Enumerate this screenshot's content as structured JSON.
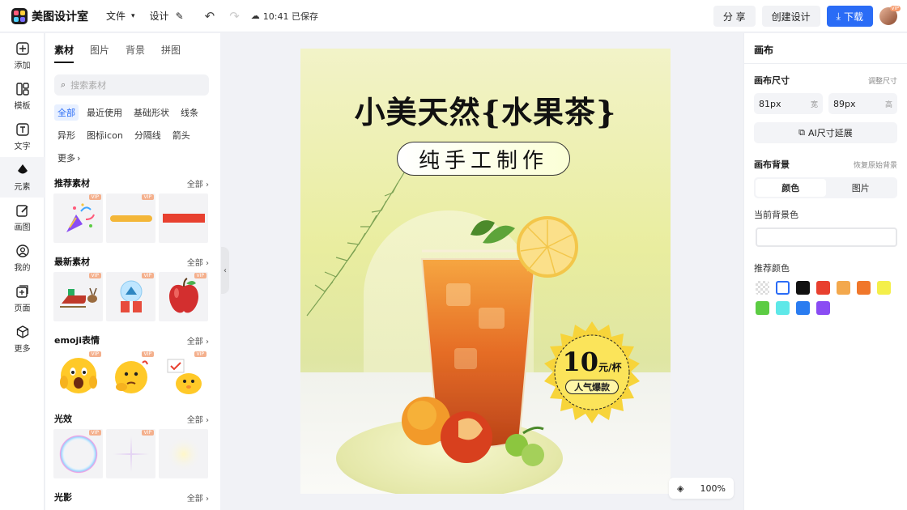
{
  "topbar": {
    "app_name": "美图设计室",
    "menu_file": "文件",
    "menu_design": "设计",
    "save_status": "10:41 已保存",
    "share_label": "分 享",
    "create_label": "创建设计",
    "download_label": "下载",
    "avatar_badge": "VIP"
  },
  "rail": {
    "items": [
      {
        "label": "添加",
        "icon": "plus-square-icon"
      },
      {
        "label": "模板",
        "icon": "template-icon"
      },
      {
        "label": "文字",
        "icon": "text-icon"
      },
      {
        "label": "元素",
        "icon": "shapes-icon"
      },
      {
        "label": "画图",
        "icon": "pen-icon"
      },
      {
        "label": "我的",
        "icon": "user-icon"
      },
      {
        "label": "页面",
        "icon": "add-page-icon"
      },
      {
        "label": "更多",
        "icon": "cube-icon"
      }
    ],
    "active_index": 3
  },
  "panel": {
    "tabs": [
      "素材",
      "图片",
      "背景",
      "拼图"
    ],
    "search_placeholder": "搜索素材",
    "chips": [
      "全部",
      "最近使用",
      "基础形状",
      "线条",
      "异形",
      "图标icon",
      "分隔线",
      "箭头",
      "更多"
    ],
    "sections": [
      {
        "title": "推荐素材",
        "more": "全部"
      },
      {
        "title": "最新素材",
        "more": "全部"
      },
      {
        "title": "emoji表情",
        "more": "全部"
      },
      {
        "title": "光效",
        "more": "全部"
      },
      {
        "title": "光影",
        "more": "全部"
      }
    ],
    "vip_label": "VIP"
  },
  "poster": {
    "title": "小美天然{水果茶}",
    "subtitle": "纯手工制作",
    "price": "10",
    "price_unit": "元/杯",
    "tag": "人气爆款"
  },
  "zoom": {
    "level": "100%"
  },
  "right": {
    "header": "画布",
    "size_label": "画布尺寸",
    "size_action": "调整尺寸",
    "width_value": "81px",
    "width_unit": "宽",
    "height_value": "89px",
    "height_unit": "高",
    "ai_expand": "AI尺寸延展",
    "bg_label": "画布背景",
    "bg_reset": "恢复原始背景",
    "seg_color": "颜色",
    "seg_image": "图片",
    "current_bg": "当前背景色",
    "recommend": "推荐颜色",
    "colors": [
      "transparent",
      "#ffffff",
      "#111111",
      "#e8402f",
      "#f3a84d",
      "#f0772b",
      "#f4ef4a",
      "#5ccc43",
      "#5ee8e8",
      "#2a7cf0",
      "#8a4cf3"
    ]
  }
}
